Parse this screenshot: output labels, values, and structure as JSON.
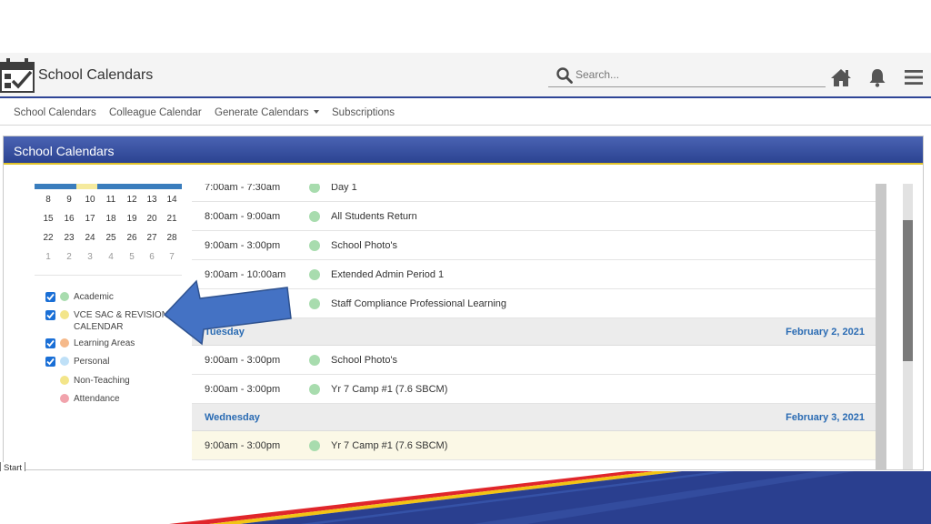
{
  "app": {
    "title": "School Calendars"
  },
  "search": {
    "placeholder": "Search..."
  },
  "topbar_icons": [
    "home-icon",
    "bell-icon",
    "menu-icon"
  ],
  "nav": {
    "items": [
      {
        "label": "School Calendars"
      },
      {
        "label": "Colleague Calendar"
      },
      {
        "label": "Generate Calendars",
        "has_dropdown": true
      },
      {
        "label": "Subscriptions"
      }
    ]
  },
  "panel": {
    "title": "School Calendars"
  },
  "mini_calendar": {
    "weeks": [
      [
        "8",
        "9",
        "10",
        "11",
        "12",
        "13",
        "14"
      ],
      [
        "15",
        "16",
        "17",
        "18",
        "19",
        "20",
        "21"
      ],
      [
        "22",
        "23",
        "24",
        "25",
        "26",
        "27",
        "28"
      ],
      [
        "1",
        "2",
        "3",
        "4",
        "5",
        "6",
        "7"
      ]
    ]
  },
  "legend": {
    "items": [
      {
        "label": "Academic",
        "checked": true,
        "color": "#a8dcae"
      },
      {
        "label": "VCE SAC & REVISION CALENDAR",
        "checked": true,
        "color": "#f3e58a"
      },
      {
        "label": "Learning Areas",
        "checked": true,
        "color": "#f5b98a"
      },
      {
        "label": "Personal",
        "checked": true,
        "color": "#bfe0f7"
      },
      {
        "label": "Non-Teaching",
        "checked": false,
        "color": "#f3e58a"
      },
      {
        "label": "Attendance",
        "checked": false,
        "color": "#f1a3ac"
      }
    ]
  },
  "events": {
    "monday": [
      {
        "time": "7:00am - 7:30am",
        "title": "Day 1"
      },
      {
        "time": "8:00am - 9:00am",
        "title": "All Students Return"
      },
      {
        "time": "9:00am - 3:00pm",
        "title": "School Photo's"
      },
      {
        "time": "9:00am - 10:00am",
        "title": "Extended Admin Period 1"
      },
      {
        "time": "",
        "title": "Staff Compliance Professional Learning"
      }
    ],
    "tuesday": {
      "day": "Tuesday",
      "date": "February 2, 2021",
      "items": [
        {
          "time": "9:00am - 3:00pm",
          "title": "School Photo's"
        },
        {
          "time": "9:00am - 3:00pm",
          "title": "Yr 7 Camp #1 (7.6 SBCM)"
        }
      ]
    },
    "wednesday": {
      "day": "Wednesday",
      "date": "February 3, 2021",
      "items": [
        {
          "time": "9:00am - 3:00pm",
          "title": "Yr 7 Camp #1 (7.6 SBCM)"
        }
      ]
    }
  },
  "start_tab": {
    "label": "Start"
  },
  "colors": {
    "accent": "#2e4596",
    "header_gradient_top": "#4a63b3",
    "header_gradient_bottom": "#2b4391",
    "header_underline": "#e0c227",
    "day_text": "#2a6bb3",
    "cal_bar_blue": "#3a7dbd",
    "cal_bar_yellow": "#f5ea9e"
  }
}
